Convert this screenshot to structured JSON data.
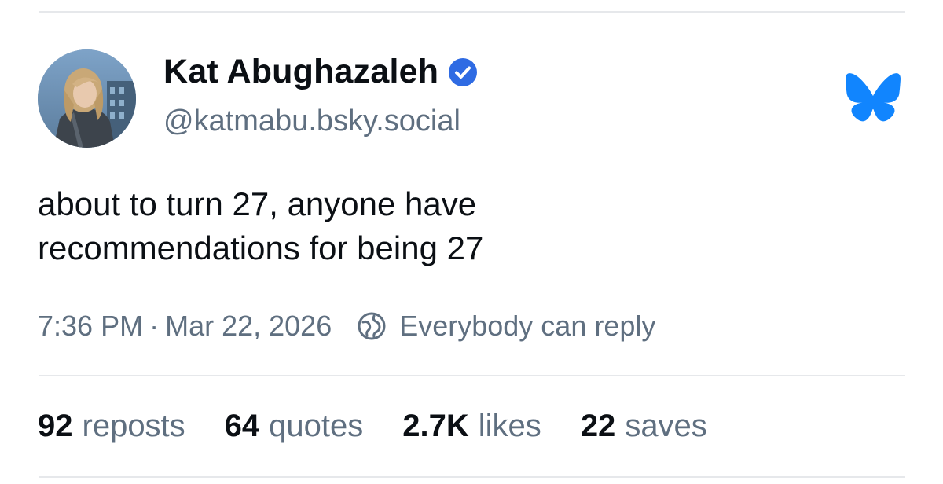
{
  "author": {
    "display_name": "Kat Abughazaleh",
    "handle": "@katmabu.bsky.social",
    "verified": true,
    "avatar": "profile-photo"
  },
  "post": {
    "lines": [
      "about to turn 27, anyone have",
      "recommendations for being 27"
    ]
  },
  "meta": {
    "time": "7:36 PM",
    "separator": "·",
    "date": "Mar 22, 2026",
    "reply_setting": "Everybody can reply",
    "reply_icon": "globe-icon"
  },
  "stats": {
    "reposts": {
      "count": "92",
      "label": "reposts"
    },
    "quotes": {
      "count": "64",
      "label": "quotes"
    },
    "likes": {
      "count": "2.7K",
      "label": "likes"
    },
    "saves": {
      "count": "22",
      "label": "saves"
    }
  },
  "icons": {
    "verified": "verified-check-icon",
    "app": "bluesky-butterfly-icon"
  },
  "colors": {
    "text": "#0b0f14",
    "muted": "#5f6f80",
    "brand": "#1185fe",
    "verified": "#2f6be3",
    "divider": "#e6e8eb"
  }
}
